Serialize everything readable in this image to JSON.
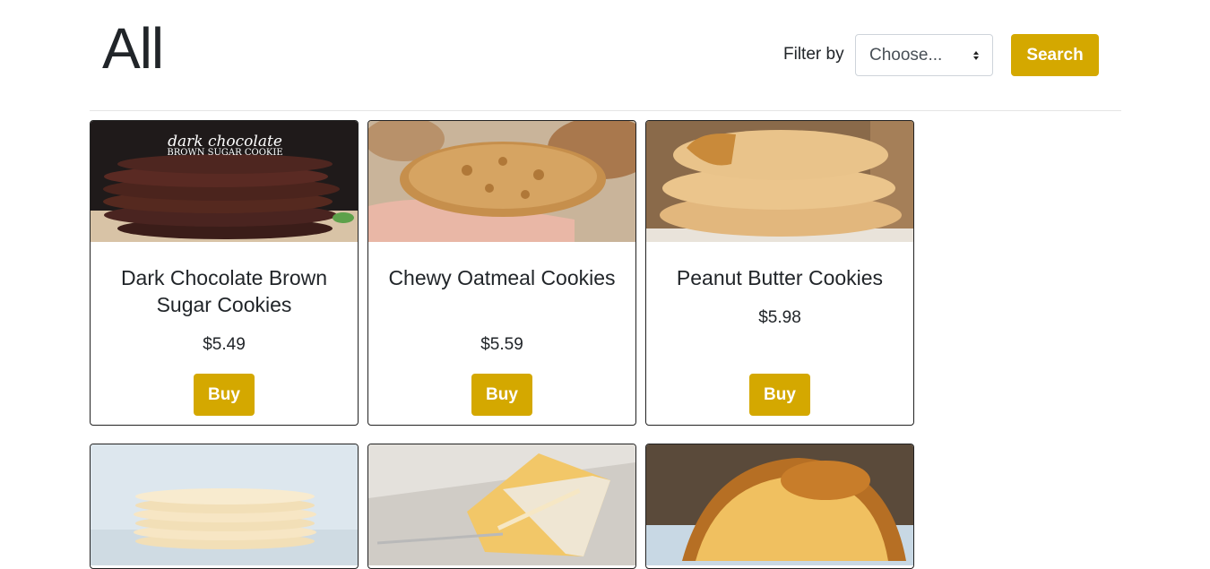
{
  "header": {
    "title": "All",
    "filter_label": "Filter by",
    "filter_value": "Choose...",
    "search_label": "Search"
  },
  "products": [
    {
      "name": "Dark Chocolate Brown Sugar Cookies",
      "price": "$5.49",
      "buy_label": "Buy",
      "image_text": "dark chocolate",
      "image_text2": "BROWN SUGAR COOKIE"
    },
    {
      "name": "Chewy Oatmeal Cookies",
      "price": "$5.59",
      "buy_label": "Buy"
    },
    {
      "name": "Peanut Butter Cookies",
      "price": "$5.98",
      "buy_label": "Buy"
    },
    {
      "name": "",
      "price": "",
      "buy_label": ""
    },
    {
      "name": "",
      "price": "",
      "buy_label": ""
    },
    {
      "name": "",
      "price": "",
      "buy_label": ""
    }
  ],
  "colors": {
    "accent": "#d4a800",
    "text": "#212529",
    "border": "#222222"
  }
}
